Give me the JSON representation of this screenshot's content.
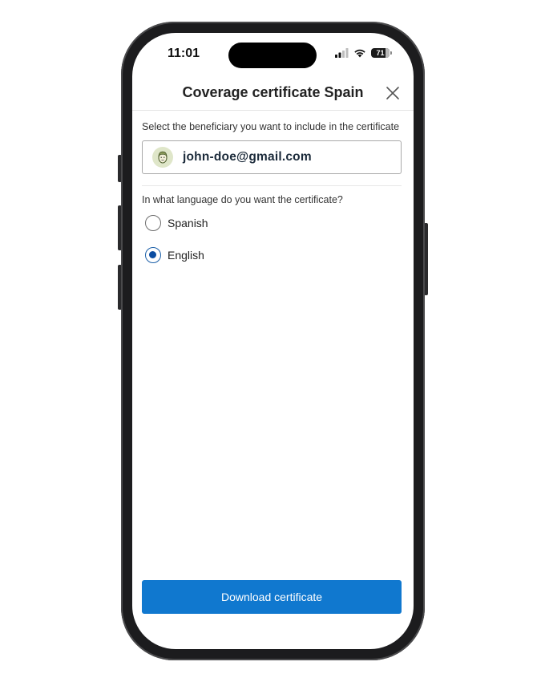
{
  "status_bar": {
    "time": "11:01",
    "battery_level": "71",
    "icons": [
      "cellular-signal-icon",
      "wifi-icon",
      "battery-icon"
    ]
  },
  "header": {
    "title": "Coverage certificate Spain",
    "close_icon": "close-icon"
  },
  "beneficiary": {
    "label": "Select the beneficiary you want to include in the certificate",
    "selected_email": "john-doe@gmail.com",
    "avatar_icon": "user-avatar-icon"
  },
  "language": {
    "label": "In what language do you want the certificate?",
    "options": [
      {
        "label": "Spanish",
        "selected": false
      },
      {
        "label": "English",
        "selected": true
      }
    ]
  },
  "actions": {
    "download_label": "Download certificate"
  },
  "colors": {
    "primary_button": "#1078cf",
    "radio_selected": "#0b4da2",
    "title_text": "#222222"
  }
}
